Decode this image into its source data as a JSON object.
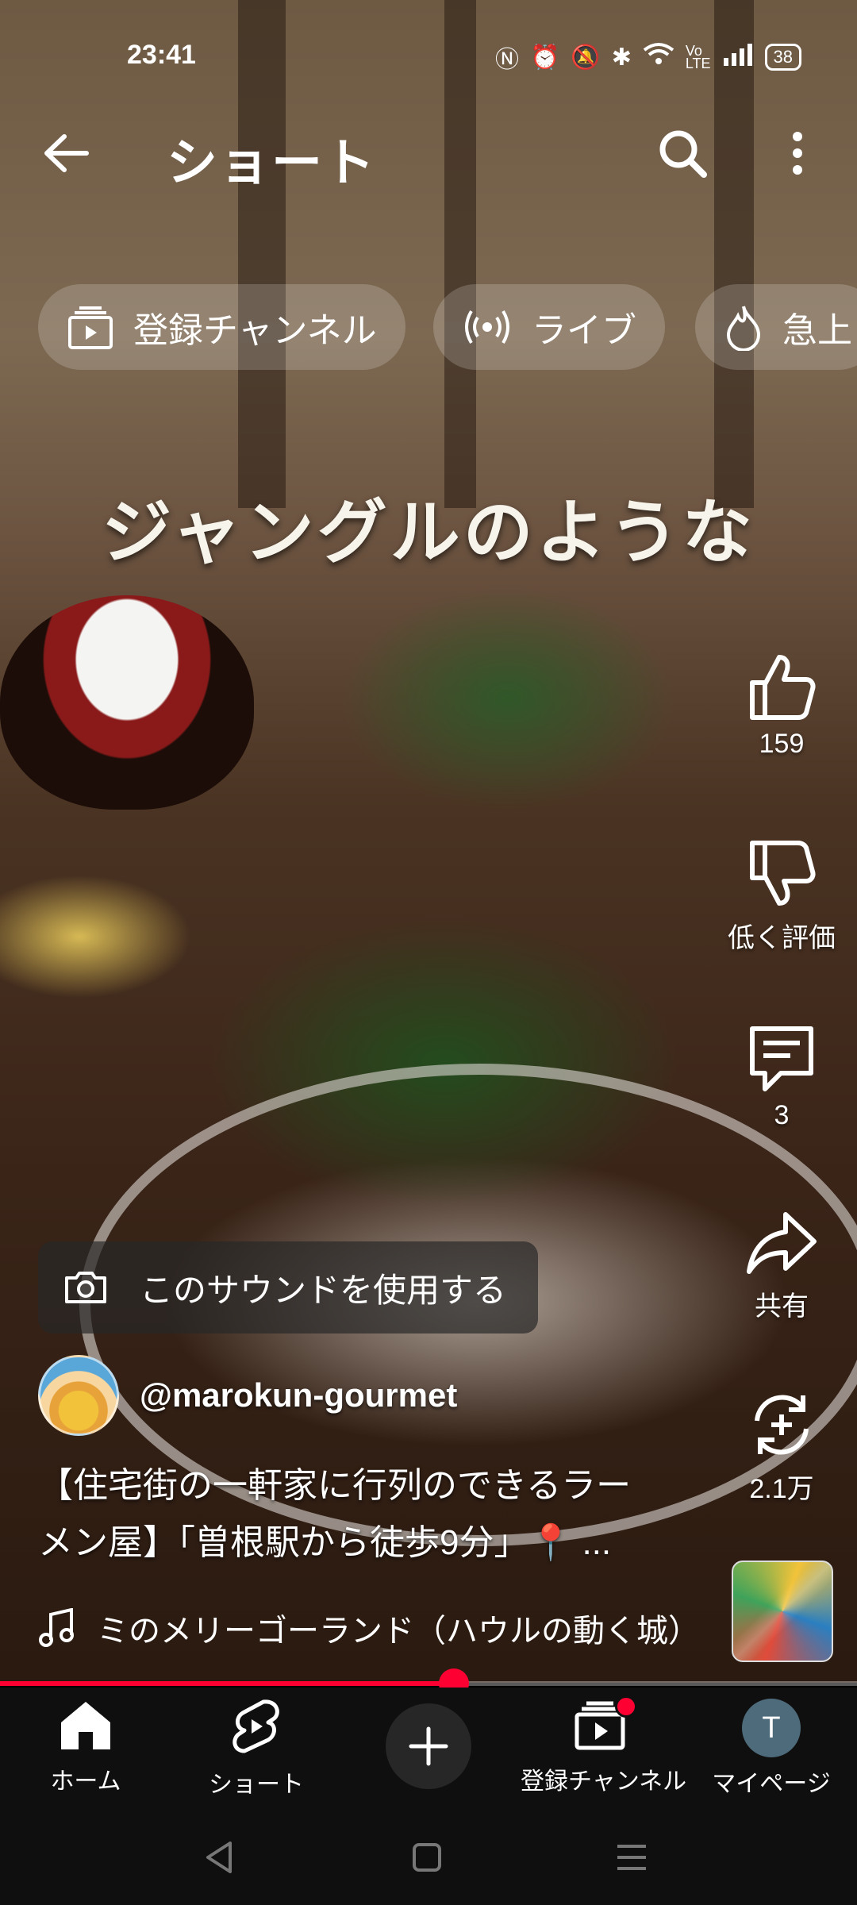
{
  "status_bar": {
    "time": "23:41",
    "battery": "38"
  },
  "header": {
    "title": "ショート"
  },
  "chips": [
    {
      "label": "登録チャンネル",
      "icon": "subscriptions-icon"
    },
    {
      "label": "ライブ",
      "icon": "live-icon"
    },
    {
      "label": "急上",
      "icon": "trending-icon"
    }
  ],
  "video": {
    "overlay_text": "ジャングルのような"
  },
  "actions": {
    "like_count": "159",
    "dislike_label": "低く評価",
    "comment_count": "3",
    "share_label": "共有",
    "remix_count": "2.1万"
  },
  "sound_pill": {
    "label": "このサウンドを使用する"
  },
  "channel": {
    "handle": "@marokun-gourmet"
  },
  "description": {
    "line1": "【住宅街の一軒家に行列のできるラー",
    "line2": "メン屋】「曽根駅から徒歩9分」📍 ..."
  },
  "music": {
    "title": "ミのメリーゴーランド（ハウルの動く城）"
  },
  "progress": {
    "fraction": 0.53
  },
  "bottom_nav": {
    "home": "ホーム",
    "shorts": "ショート",
    "subscriptions": "登録チャンネル",
    "mypage": "マイページ",
    "avatar_initial": "T"
  },
  "colors": {
    "accent": "#ff0033",
    "nav_bg": "#0f0f0f"
  }
}
